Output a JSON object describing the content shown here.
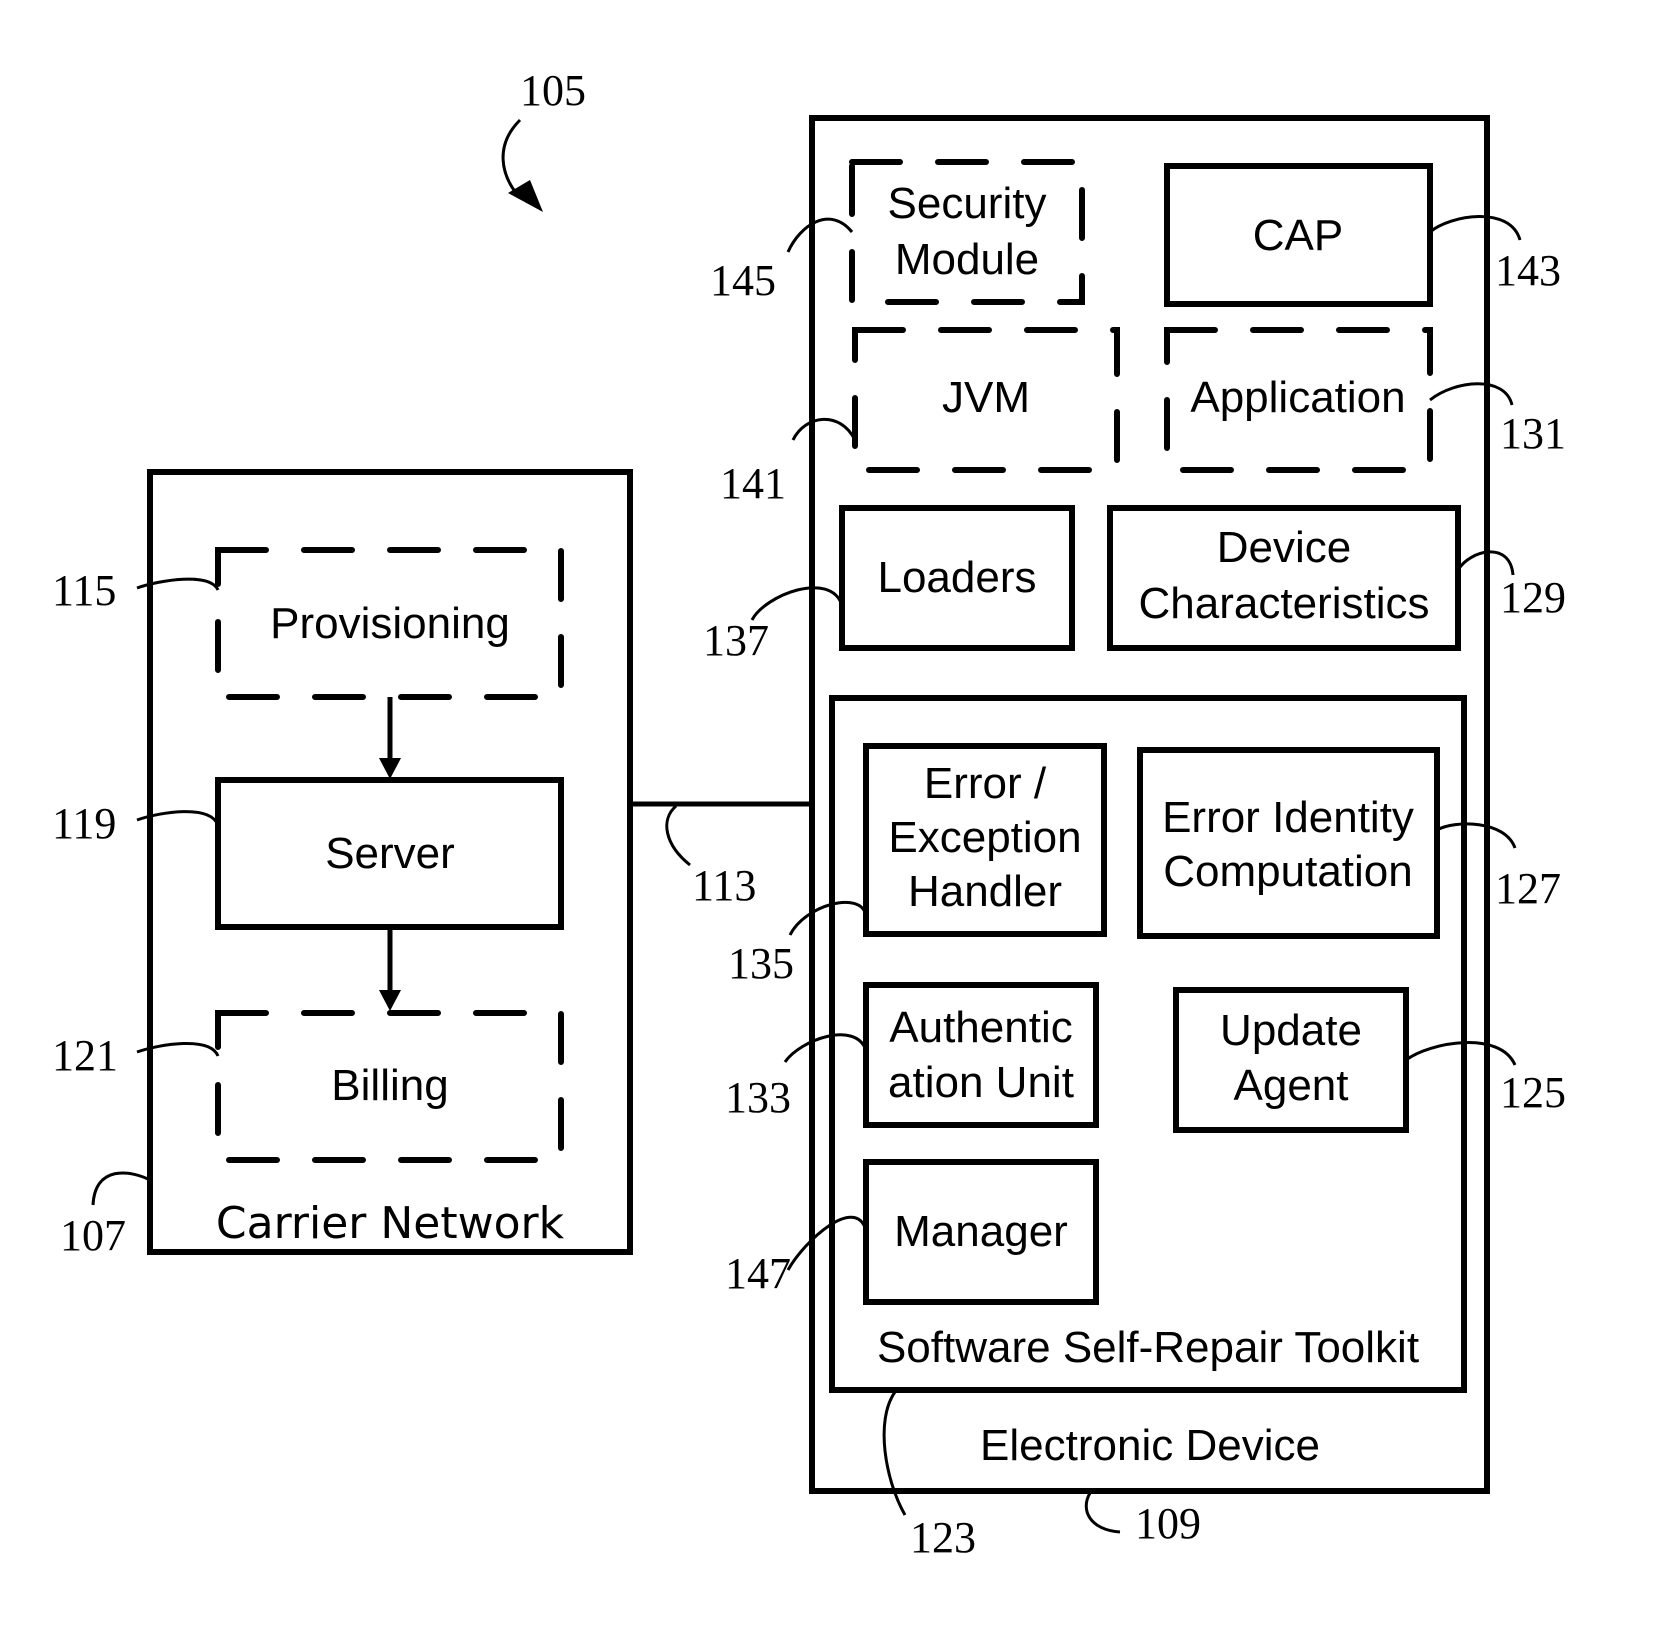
{
  "figure": {
    "ref": "105",
    "carrier_network": {
      "label": "Carrier Network",
      "ref": "107",
      "provisioning": {
        "label": "Provisioning",
        "ref": "115"
      },
      "server": {
        "label": "Server",
        "ref": "119"
      },
      "billing": {
        "label": "Billing",
        "ref": "121"
      }
    },
    "link": {
      "ref": "113"
    },
    "electronic_device": {
      "label": "Electronic Device",
      "ref": "109",
      "security_module": {
        "line1": "Security",
        "line2": "Module",
        "ref": "145"
      },
      "cap": {
        "label": "CAP",
        "ref": "143"
      },
      "jvm": {
        "label": "JVM",
        "ref": "141"
      },
      "application": {
        "label": "Application",
        "ref": "131"
      },
      "loaders": {
        "label": "Loaders",
        "ref": "137"
      },
      "device_characteristics": {
        "line1": "Device",
        "line2": "Characteristics",
        "ref": "129"
      },
      "toolkit": {
        "label": "Software Self-Repair Toolkit",
        "ref": "123",
        "error_handler": {
          "line1": "Error /",
          "line2": "Exception",
          "line3": "Handler",
          "ref": "135"
        },
        "error_identity": {
          "line1": "Error Identity",
          "line2": "Computation",
          "ref": "127"
        },
        "authentication": {
          "line1": "Authentic",
          "line2": "ation Unit",
          "ref": "133"
        },
        "update_agent": {
          "line1": "Update",
          "line2": "Agent",
          "ref": "125"
        },
        "manager": {
          "label": "Manager",
          "ref": "147"
        }
      }
    }
  }
}
